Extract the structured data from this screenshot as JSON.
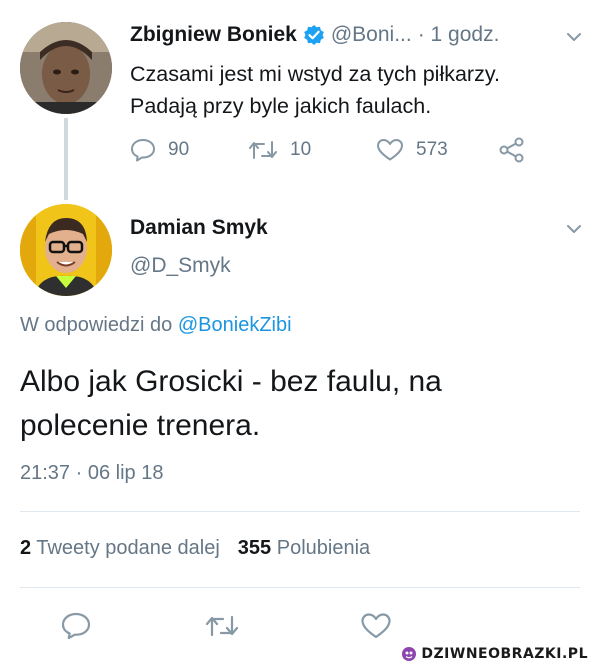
{
  "tweet_original": {
    "author_name": "Zbigniew Boniek",
    "author_handle": "@Boni...",
    "time": "· 1 godz.",
    "text_line1": "Czasami jest mi wstyd za tych piłkarzy.",
    "text_line2": "Padają przy byle jakich faulach.",
    "replies_count": "90",
    "retweets_count": "10",
    "likes_count": "573",
    "icons": {
      "verified": "verified-badge-icon",
      "caret": "chevron-down-icon",
      "reply": "reply-icon",
      "retweet": "retweet-icon",
      "like": "heart-icon",
      "share": "share-icon"
    }
  },
  "tweet_reply": {
    "author_name": "Damian Smyk",
    "author_handle": "@D_Smyk",
    "reply_prefix": "W odpowiedzi do",
    "reply_to_handle": "@BoniekZibi",
    "text_line1": "Albo jak Grosicki - bez faulu, na",
    "text_line2": "polecenie trenera.",
    "timestamp": "21:37 · 06 lip 18",
    "retweets_count": "2",
    "retweets_label": "Tweety podane dalej",
    "likes_count": "355",
    "likes_label": "Polubienia"
  },
  "watermark": {
    "text": "DZIWNEOBRAZKI.PL"
  },
  "colors": {
    "text_primary": "#14171a",
    "text_secondary": "#657786",
    "link": "#1b95e0",
    "verified": "#1da1f2",
    "divider": "#e1e8ed",
    "thread_line": "#cfd9de",
    "watermark_icon": "#8e44ad"
  }
}
